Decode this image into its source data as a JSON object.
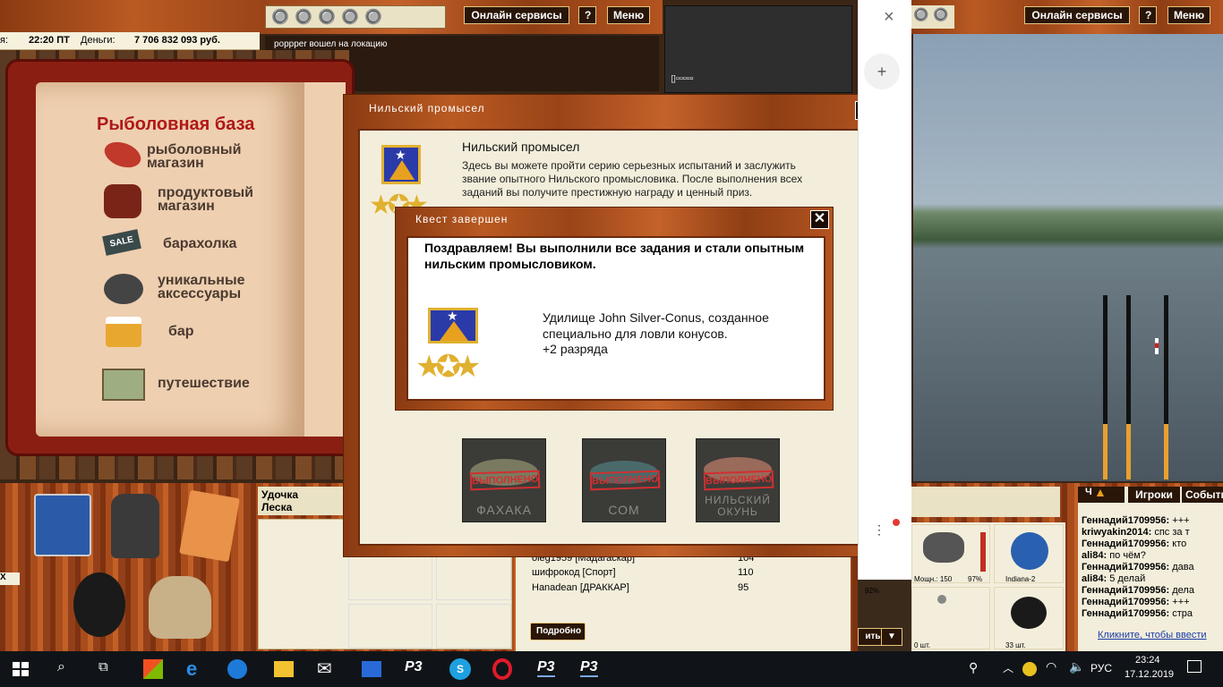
{
  "top_bar": {
    "time": "22:20 ПТ",
    "time_prefix": "я:",
    "money_label": "Деньги:",
    "money_value": "7 706 832 093 руб.",
    "online_services": "Онлайн сервисы",
    "help": "?",
    "menu": "Меню",
    "log_message": "poppper вошел на локацию",
    "signal": "▯▫▫▫▫▫"
  },
  "book": {
    "title": "Рыболовная база",
    "items": [
      {
        "label": "рыболовный магазин"
      },
      {
        "label": "продуктовый магазин"
      },
      {
        "label": "барахолка"
      },
      {
        "label": "уникальные аксессуары"
      },
      {
        "label": "бар"
      },
      {
        "label": "путешествие"
      }
    ],
    "sale_sign": "SALE"
  },
  "quest_window": {
    "title": "Нильский промысел",
    "heading": "Нильский промысел",
    "description": "Здесь вы можете пройти серию серьезных испытаний и заслужить звание опытного Нильского промысловика. После выполнения всех заданий вы получите престижную награду и ценный приз.",
    "tasks": [
      {
        "name": "ФАХАКА",
        "stamp": "ВЫПОЛНЕНО"
      },
      {
        "name": "СОМ",
        "stamp": "ВЫПОЛНЕНО"
      },
      {
        "name": "НИЛЬСКИЙ ОКУНЬ",
        "stamp": "ВЫПОЛНЕНО"
      }
    ]
  },
  "complete_dialog": {
    "title": "Квест завершен",
    "heading": "Поздравляем! Вы выполнили все задания и стали опытным нильским промысловиком.",
    "reward": "Удилище John Silver-Conus, созданное специально для ловли конусов.",
    "rank": "+2 разряда"
  },
  "bottom_panel": {
    "rod_label": "Удочка",
    "line_label": "Леска",
    "ranking": [
      {
        "name": "oleg1959 [Мадагаскар]",
        "score": "104"
      },
      {
        "name": "шифрокод [Спорт]",
        "score": "110"
      },
      {
        "name": "Hanadean [ДРАККАР]",
        "score": "95"
      }
    ],
    "details_button": "Подробно",
    "left_hint": "Х"
  },
  "browser_panel": {
    "close": "×",
    "add_user": "+"
  },
  "right_game": {
    "online_services": "Онлайн сервисы",
    "help": "?",
    "menu": "Меню",
    "tabs": [
      "Ч",
      "Игроки",
      "События"
    ],
    "chat": [
      {
        "user": "Геннадий1709956:",
        "text": "+++"
      },
      {
        "user": "kriwyakin2014:",
        "text": "спс за т"
      },
      {
        "user": "Геннадий1709956:",
        "text": "кто"
      },
      {
        "user": "ali84:",
        "text": "по чём?"
      },
      {
        "user": "Геннадий1709956:",
        "text": "дава"
      },
      {
        "user": "ali84:",
        "text": "5 делай"
      },
      {
        "user": "Геннадий1709956:",
        "text": "дела"
      },
      {
        "user": "Геннадий1709956:",
        "text": "+++"
      },
      {
        "user": "Геннадий1709956:",
        "text": "стра"
      }
    ],
    "chat_link": "Кликните, чтобы ввести",
    "inventory": [
      {
        "label": "Мощн.: 150",
        "pct": "97%"
      },
      {
        "label": "Indiana-2",
        "pct": ""
      },
      {
        "label": "0 шт.",
        "pct": ""
      },
      {
        "label": "33 шт.",
        "pct": ""
      }
    ],
    "pct_left": "92%",
    "send_label": "ить"
  },
  "taskbar": {
    "lang": "РУС",
    "time": "23:24",
    "date": "17.12.2019",
    "rr3": "Р3"
  },
  "colors": {
    "wood": "#a84c1c",
    "cream": "#f3eedb",
    "accent_red": "#b01818",
    "taskbar": "#101418"
  }
}
